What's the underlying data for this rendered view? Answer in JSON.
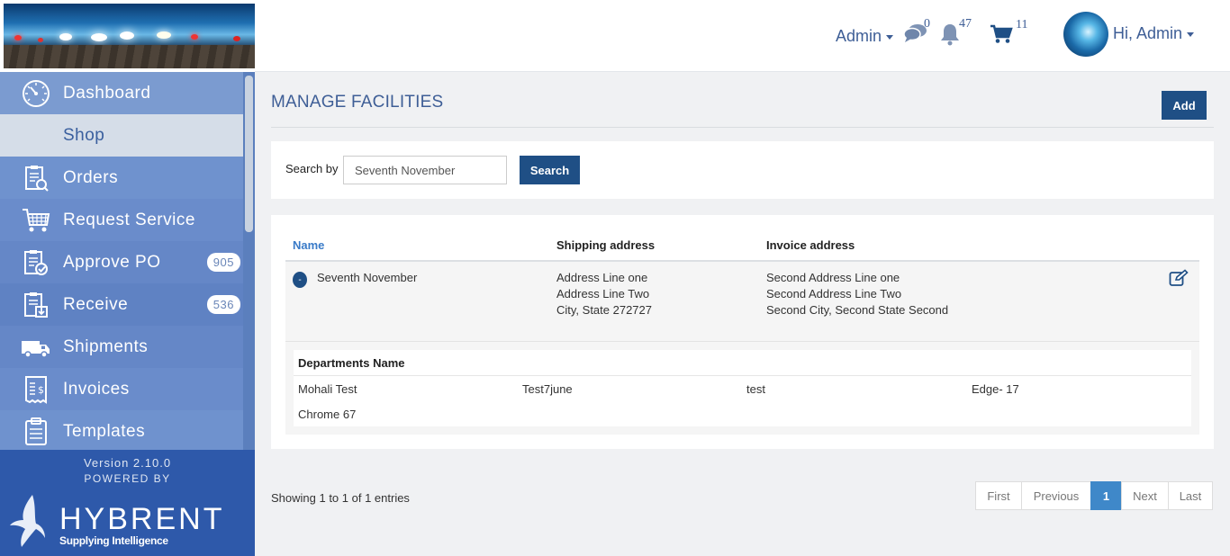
{
  "sidebar": {
    "items": [
      {
        "label": "Dashboard",
        "icon": "dashboard-gauge-icon"
      },
      {
        "label": "Shop"
      },
      {
        "label": "Orders",
        "icon": "orders-clipboard-icon"
      },
      {
        "label": "Request Service",
        "icon": "request-service-cart-icon"
      },
      {
        "label": "Approve PO",
        "icon": "approve-po-icon",
        "badge": "905"
      },
      {
        "label": "Receive",
        "icon": "receive-icon",
        "badge": "536"
      },
      {
        "label": "Shipments",
        "icon": "truck-icon"
      },
      {
        "label": "Invoices",
        "icon": "invoice-icon"
      },
      {
        "label": "Templates",
        "icon": "templates-icon"
      }
    ],
    "version": "Version 2.10.0",
    "powered_by": "POWERED BY",
    "logo_text": "HYBRENT",
    "logo_tagline": "Supplying Intelligence"
  },
  "header": {
    "admin_menu": "Admin",
    "messages_count": "0",
    "notifications_count": "47",
    "cart_count": "11",
    "greeting": "Hi, Admin"
  },
  "main": {
    "title": "MANAGE FACILITIES",
    "add_label": "Add",
    "search": {
      "label": "Search by",
      "value": "Seventh November",
      "button": "Search"
    },
    "table": {
      "columns": [
        "Name",
        "Shipping address",
        "Invoice address"
      ],
      "row": {
        "toggle": "-",
        "name": "Seventh November",
        "shipping": [
          "Address Line one",
          "Address Line Two",
          "City, State 272727"
        ],
        "invoice": [
          "Second Address Line one",
          "Second Address Line Two",
          "Second City, Second State Second"
        ]
      },
      "departments_header": "Departments Name",
      "departments": [
        "Mohali Test",
        "Test7june",
        "test",
        "Edge- 17",
        "Chrome 67"
      ]
    },
    "showing": "Showing 1 to 1 of 1 entries",
    "pagination": [
      "First",
      "Previous",
      "1",
      "Next",
      "Last"
    ]
  },
  "colors": {
    "brand": "#1f4f85",
    "sidebar": "#3d62a8",
    "link": "#3a7bc8",
    "active_page": "#3f88c9"
  }
}
